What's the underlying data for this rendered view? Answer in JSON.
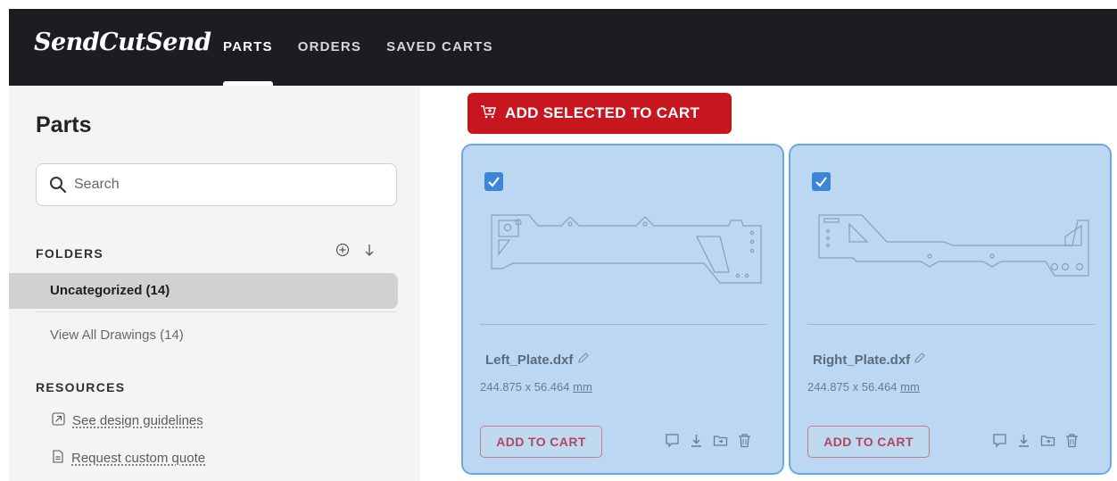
{
  "app": {
    "logo": "SendCutSend",
    "nav": [
      {
        "label": "PARTS",
        "active": true
      },
      {
        "label": "ORDERS",
        "active": false
      },
      {
        "label": "SAVED CARTS",
        "active": false
      }
    ]
  },
  "sidebar": {
    "title": "Parts",
    "search_placeholder": "Search",
    "folders_heading": "FOLDERS",
    "folder_actions": [
      "add-folder-icon",
      "sort-icon"
    ],
    "folders": [
      {
        "label": "Uncategorized (14)",
        "selected": true
      },
      {
        "label": "View All Drawings (14)",
        "selected": false
      }
    ],
    "resources_heading": "RESOURCES",
    "resources": [
      {
        "label": "See design guidelines",
        "icon": "external-link-icon"
      },
      {
        "label": "Request custom quote",
        "icon": "document-icon"
      }
    ]
  },
  "main": {
    "add_selected_label": "ADD SELECTED TO CART",
    "parts": [
      {
        "name": "Left_Plate.dxf",
        "dims": "244.875 x 56.464",
        "unit": "mm",
        "checked": true,
        "add_label": "ADD TO CART"
      },
      {
        "name": "Right_Plate.dxf",
        "dims": "244.875 x 56.464",
        "unit": "mm",
        "checked": true,
        "add_label": "ADD TO CART"
      }
    ],
    "card_actions": [
      "comment-icon",
      "download-icon",
      "move-to-folder-icon",
      "delete-icon"
    ]
  },
  "colors": {
    "header_bg": "#1d1c21",
    "accent_red": "#c8161e",
    "selected_card": "#bcd7f1",
    "card_border": "#6aa8e0",
    "checkbox": "#3a86d8"
  }
}
